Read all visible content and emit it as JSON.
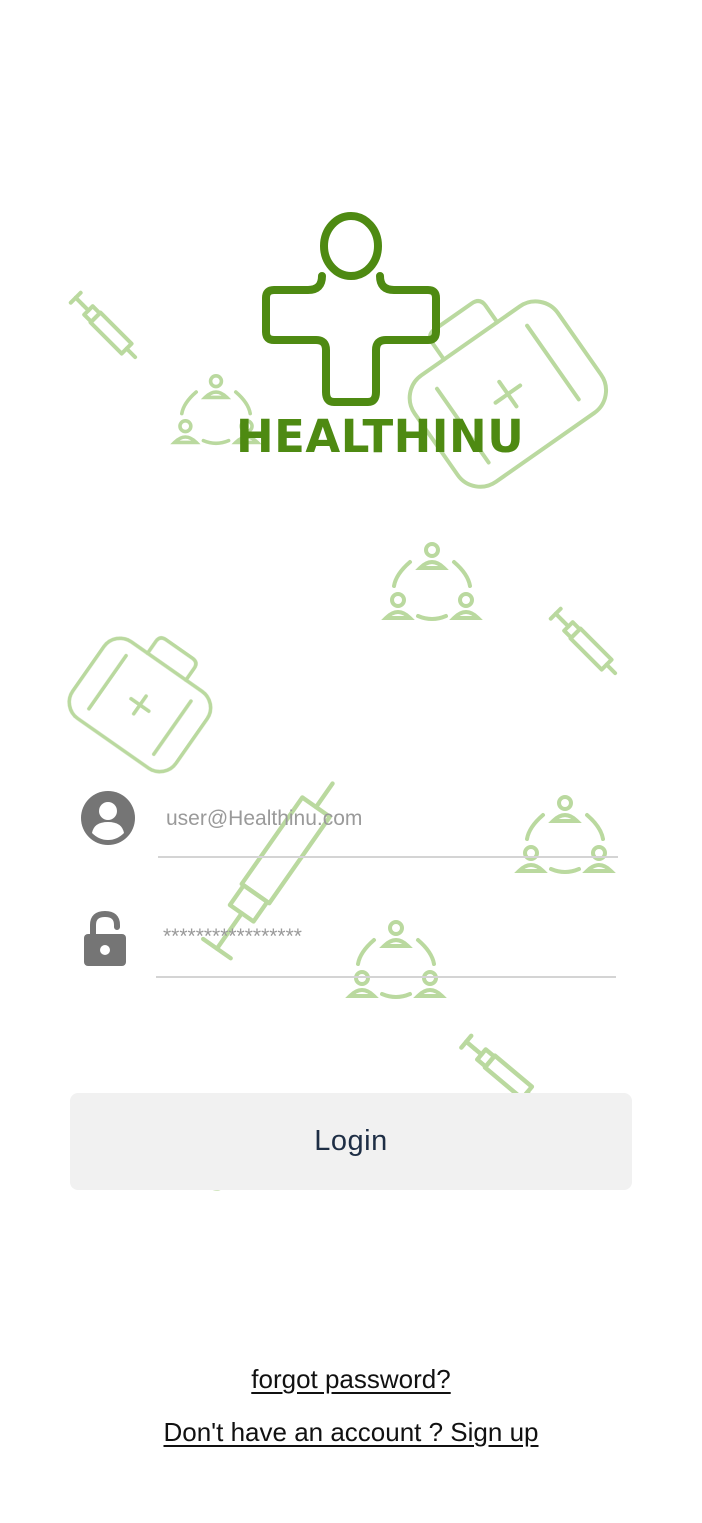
{
  "app": {
    "brand_name": "HEALTHINU",
    "brand_color": "#4e8a12",
    "decor_color": "#a8cf85"
  },
  "login_form": {
    "username": {
      "placeholder": "user@Healthinu.com",
      "icon": "account-circle-icon"
    },
    "password": {
      "placeholder": "*****************",
      "icon": "lock-open-icon"
    },
    "login_label": "Login"
  },
  "links": {
    "forgot_password": "forgot password?",
    "signup": "Don't have an account ? Sign up"
  }
}
